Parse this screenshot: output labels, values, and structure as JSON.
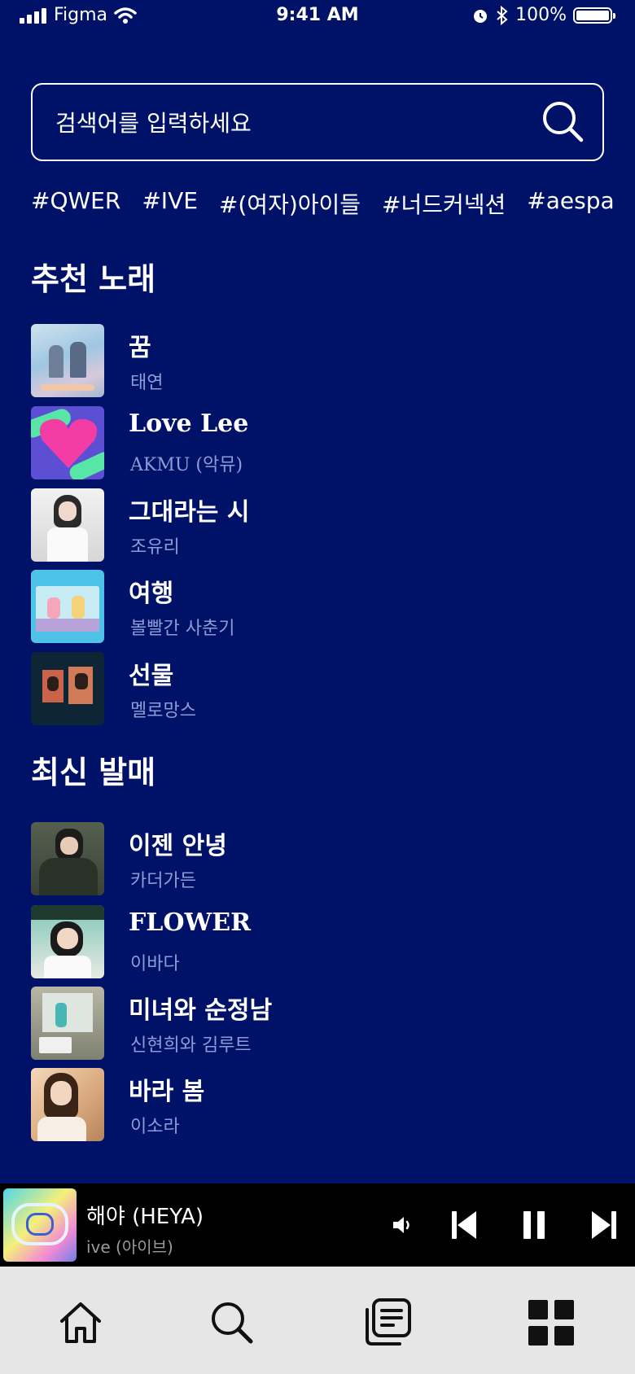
{
  "status": {
    "carrier": "Figma",
    "time": "9:41 AM",
    "battery": "100%"
  },
  "search": {
    "placeholder": "검색어를 입력하세요"
  },
  "hashtags": [
    "#QWER",
    "#IVE",
    "#(여자)아이들",
    "#너드커넥션",
    "#aespa"
  ],
  "recommended": {
    "title": "추천 노래",
    "songs": [
      {
        "title": "꿈",
        "artist": "태연"
      },
      {
        "title": "Love Lee",
        "artist": "AKMU (악뮤)"
      },
      {
        "title": "그대라는 시",
        "artist": "조유리"
      },
      {
        "title": "여행",
        "artist": "볼빨간 사춘기"
      },
      {
        "title": "선물",
        "artist": "멜로망스"
      }
    ]
  },
  "latest": {
    "title": "최신 발매",
    "songs": [
      {
        "title": "이젠 안녕",
        "artist": "카더가든"
      },
      {
        "title": "FLOWER",
        "artist": "이바다"
      },
      {
        "title": "미녀와 순정남",
        "artist": "신현희와 김루트"
      },
      {
        "title": "바라 봄",
        "artist": "이소라"
      }
    ]
  },
  "player": {
    "title": "해야 (HEYA)",
    "artist": "ive (아이브)"
  },
  "colors": {
    "background": "#001268",
    "player_bg": "#000000",
    "tabbar_bg": "#e6e6e6",
    "artist_text": "#8f9bd6"
  },
  "icons": {
    "tabs": [
      "home-icon",
      "search-icon",
      "library-icon",
      "grid-icon"
    ],
    "player_controls": [
      "volume-icon",
      "previous-icon",
      "pause-icon",
      "next-icon"
    ]
  }
}
